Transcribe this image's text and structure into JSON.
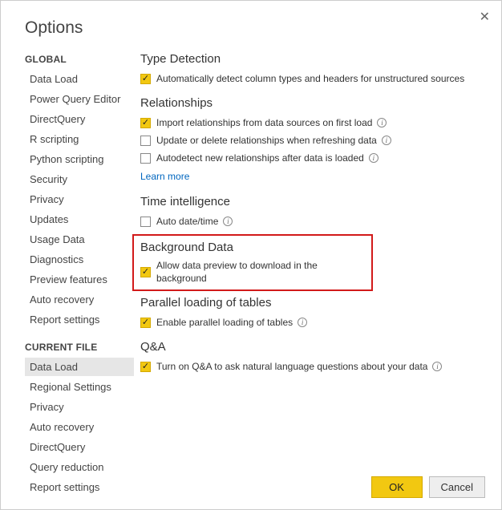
{
  "dialog": {
    "title": "Options"
  },
  "sidebar": {
    "global_label": "GLOBAL",
    "global_items": [
      "Data Load",
      "Power Query Editor",
      "DirectQuery",
      "R scripting",
      "Python scripting",
      "Security",
      "Privacy",
      "Updates",
      "Usage Data",
      "Diagnostics",
      "Preview features",
      "Auto recovery",
      "Report settings"
    ],
    "current_label": "CURRENT FILE",
    "current_items": [
      "Data Load",
      "Regional Settings",
      "Privacy",
      "Auto recovery",
      "DirectQuery",
      "Query reduction",
      "Report settings"
    ],
    "selected": "Data Load"
  },
  "sections": {
    "type_detection": {
      "title": "Type Detection",
      "opt1": "Automatically detect column types and headers for unstructured sources"
    },
    "relationships": {
      "title": "Relationships",
      "opt1": "Import relationships from data sources on first load",
      "opt2": "Update or delete relationships when refreshing data",
      "opt3": "Autodetect new relationships after data is loaded",
      "learn_more": "Learn more"
    },
    "time_intel": {
      "title": "Time intelligence",
      "opt1": "Auto date/time"
    },
    "background": {
      "title": "Background Data",
      "opt1": "Allow data preview to download in the background"
    },
    "parallel": {
      "title": "Parallel loading of tables",
      "opt1": "Enable parallel loading of tables"
    },
    "qa": {
      "title": "Q&A",
      "opt1": "Turn on Q&A to ask natural language questions about your data"
    }
  },
  "buttons": {
    "ok": "OK",
    "cancel": "Cancel"
  }
}
